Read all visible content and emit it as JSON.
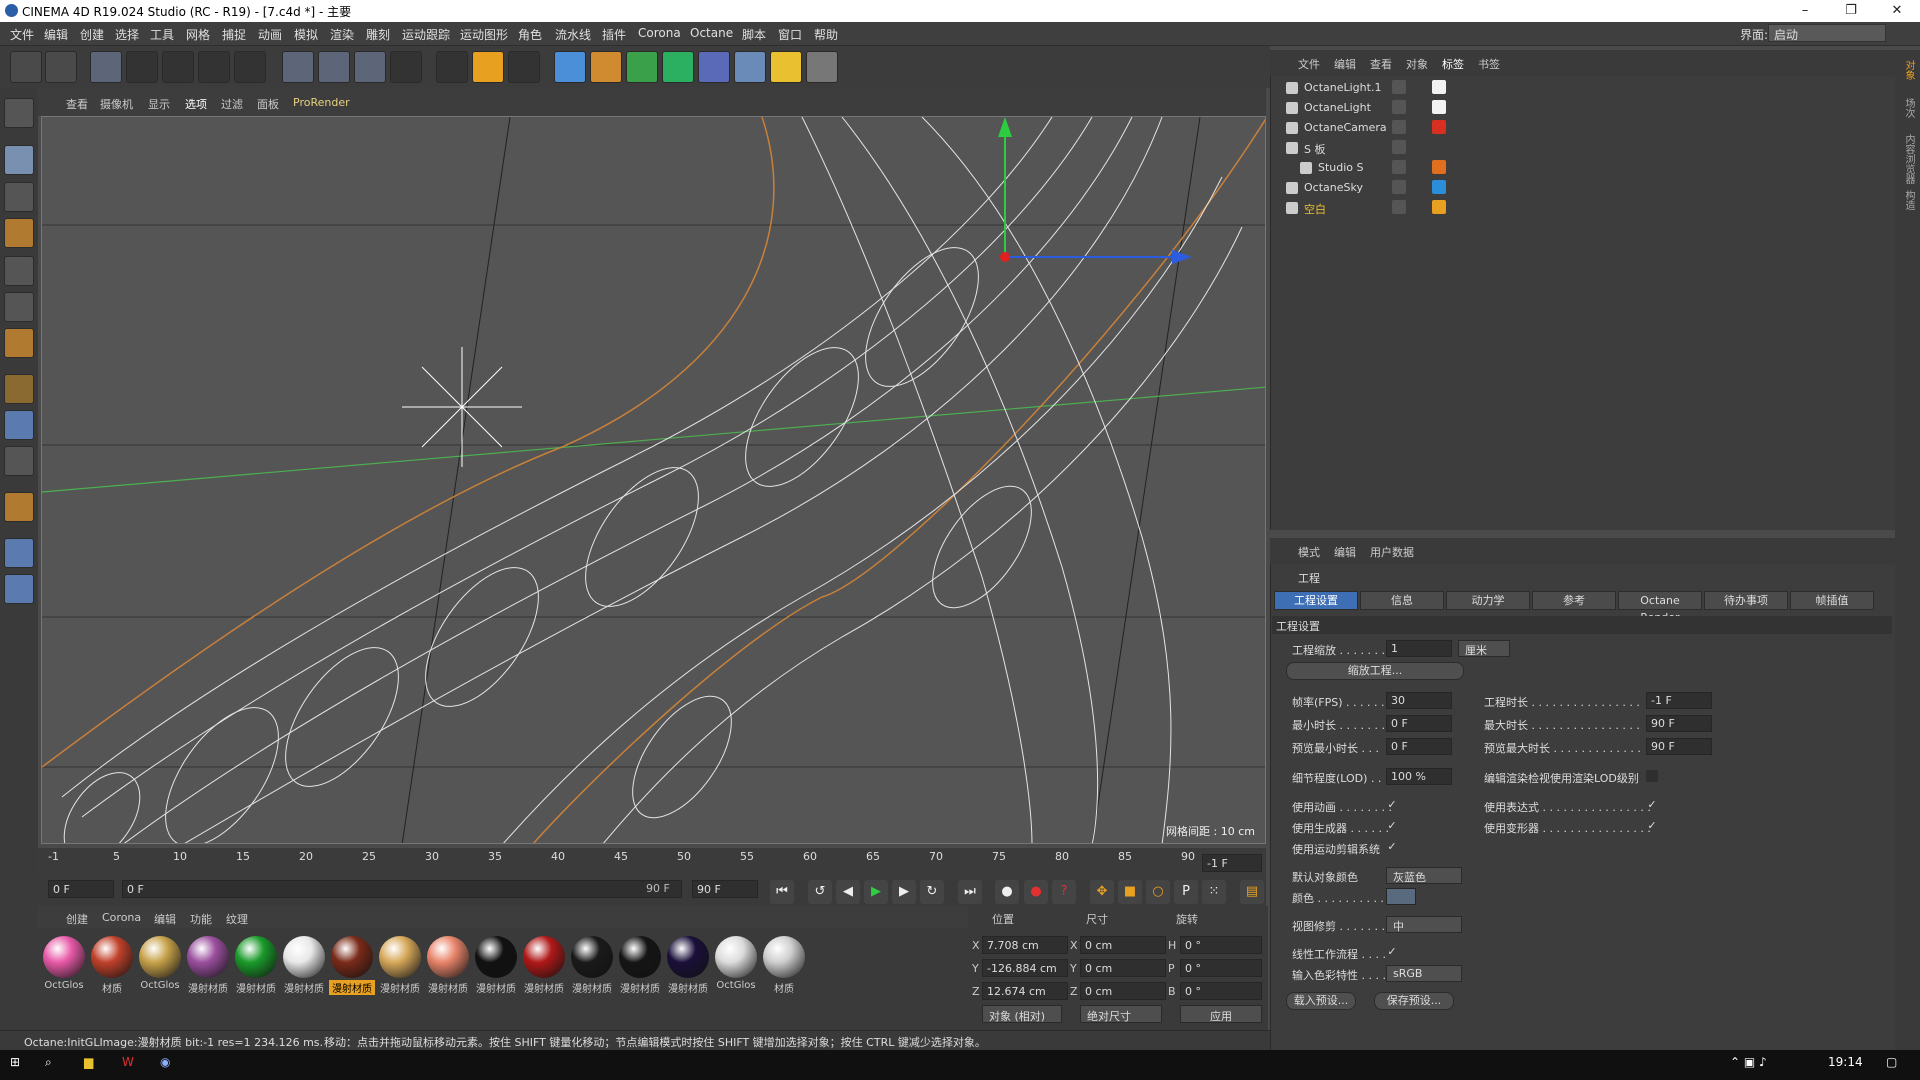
{
  "window": {
    "title": "CINEMA 4D R19.024 Studio (RC - R19) - [7.c4d *] - 主要",
    "min": "–",
    "max": "❐",
    "close": "✕"
  },
  "menu": [
    "文件",
    "编辑",
    "创建",
    "选择",
    "工具",
    "网格",
    "捕捉",
    "动画",
    "模拟",
    "渲染",
    "雕刻",
    "运动跟踪",
    "运动图形",
    "角色",
    "流水线",
    "插件",
    "Corona",
    "Octane",
    "脚本",
    "窗口",
    "帮助"
  ],
  "layout": {
    "label": "界面:",
    "value": "启动"
  },
  "viewport_menu": [
    "查看",
    "摄像机",
    "显示",
    "选项",
    "过滤",
    "面板",
    "ProRender"
  ],
  "viewport": {
    "grid_label": "网格间距 : 10 cm"
  },
  "timeline": {
    "ticks": [
      "-1",
      "5",
      "10",
      "15",
      "20",
      "25",
      "30",
      "35",
      "40",
      "45",
      "50",
      "55",
      "60",
      "65",
      "70",
      "75",
      "80",
      "85",
      "90"
    ],
    "current_frame": "-1 F",
    "start": "0 F",
    "range_start": "0 F",
    "range_end": "90 F",
    "end": "90 F"
  },
  "material_menu": [
    "创建",
    "Corona",
    "编辑",
    "功能",
    "纹理"
  ],
  "materials": [
    {
      "label": "OctGlos",
      "color": "#e85aa8"
    },
    {
      "label": "材质",
      "color": "#c0412a"
    },
    {
      "label": "OctGlos",
      "color": "#c7a24a"
    },
    {
      "label": "漫射材质",
      "color": "#9b4f9e"
    },
    {
      "label": "漫射材质",
      "color": "#1a9a2a"
    },
    {
      "label": "漫射材质",
      "color": "#e8e8e8"
    },
    {
      "label": "漫射材质",
      "color": "#7a2a18"
    },
    {
      "label": "漫射材质",
      "color": "#d6a85a"
    },
    {
      "label": "漫射材质",
      "color": "#e8846a"
    },
    {
      "label": "漫射材质",
      "color": "#111111"
    },
    {
      "label": "漫射材质",
      "color": "#b01818"
    },
    {
      "label": "漫射材质",
      "color": "#1a1a1a"
    },
    {
      "label": "漫射材质",
      "color": "#151515"
    },
    {
      "label": "漫射材质",
      "color": "#1a0f3a"
    },
    {
      "label": "OctGlos",
      "color": "#dcdcdc"
    },
    {
      "label": "材质",
      "color": "#cfcfcf"
    }
  ],
  "coords": {
    "h_pos": "位置",
    "h_size": "尺寸",
    "h_rot": "旋转",
    "x": "7.708 cm",
    "y": "-126.884 cm",
    "z": "12.674 cm",
    "sx": "0 cm",
    "sy": "0 cm",
    "sz": "0 cm",
    "h": "0 °",
    "p": "0 °",
    "b": "0 °",
    "mode": "对象 (相对)",
    "size_mode": "绝对尺寸",
    "apply": "应用",
    "lx": "X",
    "ly": "Y",
    "lz": "Z",
    "lsx": "X",
    "lsy": "Y",
    "lsz": "Z",
    "lh": "H",
    "lp": "P",
    "lb": "B"
  },
  "status": {
    "left": "Octane:InitGLImage:漫射材质  bit:-1 res=1  234.126 ms.",
    "right": "移动：点击并拖动鼠标移动元素。按住 SHIFT 键量化移动；节点编辑模式时按住 SHIFT 键增加选择对象；按住 CTRL 键减少选择对象。"
  },
  "object_menu": [
    "文件",
    "编辑",
    "查看",
    "对象",
    "标签",
    "书签"
  ],
  "objects": [
    {
      "name": "OctaneLight.1",
      "indent": 0,
      "tagcolor": "#f2f2f2"
    },
    {
      "name": "OctaneLight",
      "indent": 0,
      "tagcolor": "#f2f2f2"
    },
    {
      "name": "OctaneCamera",
      "indent": 0,
      "tagcolor": "#d83020"
    },
    {
      "name": "S 板",
      "indent": 0,
      "tagcolor": ""
    },
    {
      "name": "Studio S",
      "indent": 1,
      "tagcolor": "#e07020"
    },
    {
      "name": "OctaneSky",
      "indent": 0,
      "tagcolor": "#2a8fd8"
    },
    {
      "name": "空白",
      "indent": 0,
      "tagcolor": "#e8a020"
    }
  ],
  "attr_menu": [
    "模式",
    "编辑",
    "用户数据"
  ],
  "attr": {
    "header": "工程",
    "tabs": [
      "工程设置",
      "信息",
      "动力学",
      "参考",
      "Octane Render",
      "待办事项",
      "帧插值"
    ],
    "section": "工程设置",
    "scale_label": "工程缩放 . . . . . . .",
    "scale_value": "1",
    "scale_unit": "厘米",
    "scale_btn": "缩放工程...",
    "fps_label": "帧率(FPS) . . . . . . .",
    "fps": "30",
    "time_label": "工程时长 . . . . . . . . . . . . . . . .",
    "time": "-1 F",
    "min_label": "最小时长 . . . . . . .",
    "min": "0 F",
    "max_label": "最大时长 . . . . . . . . . . . . . . . .",
    "max": "90 F",
    "pmin_label": "预览最小时长 . . .",
    "pmin": "0 F",
    "pmax_label": "预览最大时长 . . . . . . . . . . . . .",
    "pmax": "90 F",
    "lod_label": "细节程度(LOD) . . .",
    "lod": "100 %",
    "lod_render_label": "编辑渲染检视使用渲染LOD级别",
    "anim_label": "使用动画 . . . . . . . .",
    "expr_label": "使用表达式 . . . . . . . . . . . . . . . .",
    "gen_label": "使用生成器 . . . . . .",
    "deform_label": "使用变形器 . . . . . . . . . . . . . . . .",
    "motion_label": "使用运动剪辑系统",
    "defcol_label": "默认对象颜色",
    "defcol": "灰蓝色",
    "color_label": "颜色 . . . . . . . . . . .",
    "vp_label": "视图修剪 . . . . . . . .",
    "vp": "中",
    "linear_label": "线性工作流程 . . . .",
    "input_label": "输入色彩特性 . . . .",
    "input": "sRGB",
    "load_btn": "载入预设...",
    "save_btn": "保存预设..."
  },
  "side_tabs": [
    "对象",
    "场次",
    "内容浏览器",
    "构造"
  ],
  "taskbar": {
    "time": "19:14"
  }
}
